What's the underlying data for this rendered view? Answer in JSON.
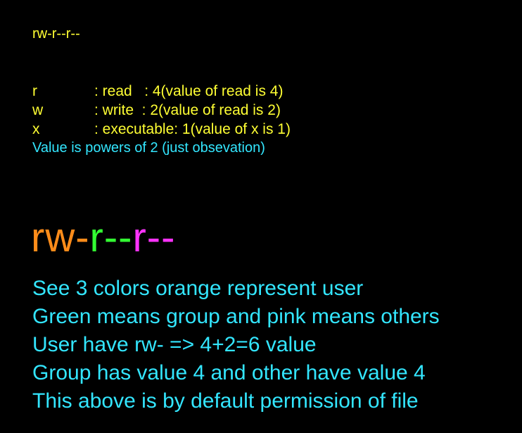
{
  "top_line": "rw-r--r--",
  "legend": [
    {
      "letter": "r",
      "desc": ": read   : 4(value of read is 4)"
    },
    {
      "letter": "w",
      "desc": ": write  : 2(value of read is 2)"
    },
    {
      "letter": "x",
      "desc": ": executable: 1(value of x is 1)"
    }
  ],
  "note": "Value is powers of 2 (just obsevation)",
  "big_permission": {
    "user": "rw-",
    "group": "r--",
    "other": "r--"
  },
  "explanation": [
    "See 3 colors orange represent user",
    "Green means group and pink means others",
    "User have rw- => 4+2=6 value",
    "Group has value 4 and other have value 4",
    "This above is by default permission of file"
  ],
  "colors": {
    "background": "#000000",
    "yellow_text": "#ffff33",
    "cyan_text": "#33e6ff",
    "user_orange": "#ff8c1a",
    "group_green": "#33ff33",
    "other_pink": "#ff33ff"
  }
}
